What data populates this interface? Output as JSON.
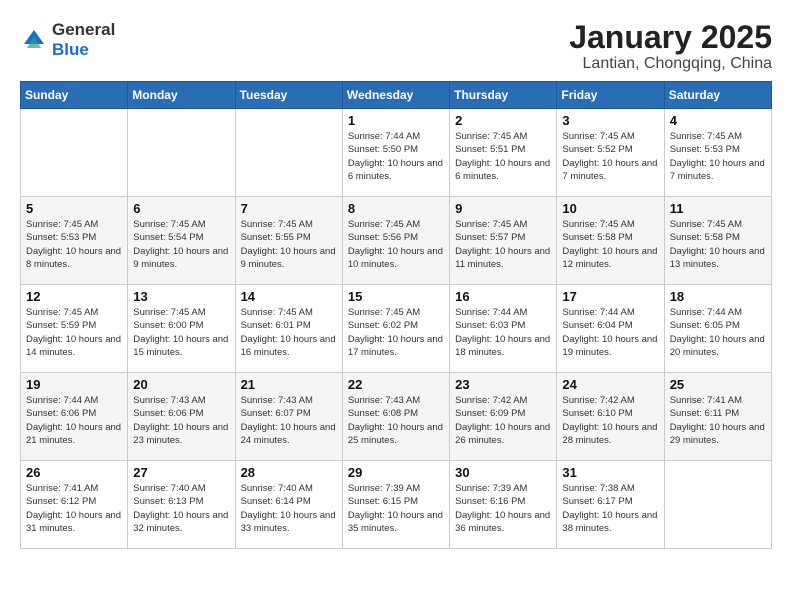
{
  "logo": {
    "text_general": "General",
    "text_blue": "Blue"
  },
  "header": {
    "month_year": "January 2025",
    "location": "Lantian, Chongqing, China"
  },
  "weekdays": [
    "Sunday",
    "Monday",
    "Tuesday",
    "Wednesday",
    "Thursday",
    "Friday",
    "Saturday"
  ],
  "weeks": [
    [
      {
        "day": "",
        "info": ""
      },
      {
        "day": "",
        "info": ""
      },
      {
        "day": "",
        "info": ""
      },
      {
        "day": "1",
        "info": "Sunrise: 7:44 AM\nSunset: 5:50 PM\nDaylight: 10 hours and 6 minutes."
      },
      {
        "day": "2",
        "info": "Sunrise: 7:45 AM\nSunset: 5:51 PM\nDaylight: 10 hours and 6 minutes."
      },
      {
        "day": "3",
        "info": "Sunrise: 7:45 AM\nSunset: 5:52 PM\nDaylight: 10 hours and 7 minutes."
      },
      {
        "day": "4",
        "info": "Sunrise: 7:45 AM\nSunset: 5:53 PM\nDaylight: 10 hours and 7 minutes."
      }
    ],
    [
      {
        "day": "5",
        "info": "Sunrise: 7:45 AM\nSunset: 5:53 PM\nDaylight: 10 hours and 8 minutes."
      },
      {
        "day": "6",
        "info": "Sunrise: 7:45 AM\nSunset: 5:54 PM\nDaylight: 10 hours and 9 minutes."
      },
      {
        "day": "7",
        "info": "Sunrise: 7:45 AM\nSunset: 5:55 PM\nDaylight: 10 hours and 9 minutes."
      },
      {
        "day": "8",
        "info": "Sunrise: 7:45 AM\nSunset: 5:56 PM\nDaylight: 10 hours and 10 minutes."
      },
      {
        "day": "9",
        "info": "Sunrise: 7:45 AM\nSunset: 5:57 PM\nDaylight: 10 hours and 11 minutes."
      },
      {
        "day": "10",
        "info": "Sunrise: 7:45 AM\nSunset: 5:58 PM\nDaylight: 10 hours and 12 minutes."
      },
      {
        "day": "11",
        "info": "Sunrise: 7:45 AM\nSunset: 5:58 PM\nDaylight: 10 hours and 13 minutes."
      }
    ],
    [
      {
        "day": "12",
        "info": "Sunrise: 7:45 AM\nSunset: 5:59 PM\nDaylight: 10 hours and 14 minutes."
      },
      {
        "day": "13",
        "info": "Sunrise: 7:45 AM\nSunset: 6:00 PM\nDaylight: 10 hours and 15 minutes."
      },
      {
        "day": "14",
        "info": "Sunrise: 7:45 AM\nSunset: 6:01 PM\nDaylight: 10 hours and 16 minutes."
      },
      {
        "day": "15",
        "info": "Sunrise: 7:45 AM\nSunset: 6:02 PM\nDaylight: 10 hours and 17 minutes."
      },
      {
        "day": "16",
        "info": "Sunrise: 7:44 AM\nSunset: 6:03 PM\nDaylight: 10 hours and 18 minutes."
      },
      {
        "day": "17",
        "info": "Sunrise: 7:44 AM\nSunset: 6:04 PM\nDaylight: 10 hours and 19 minutes."
      },
      {
        "day": "18",
        "info": "Sunrise: 7:44 AM\nSunset: 6:05 PM\nDaylight: 10 hours and 20 minutes."
      }
    ],
    [
      {
        "day": "19",
        "info": "Sunrise: 7:44 AM\nSunset: 6:06 PM\nDaylight: 10 hours and 21 minutes."
      },
      {
        "day": "20",
        "info": "Sunrise: 7:43 AM\nSunset: 6:06 PM\nDaylight: 10 hours and 23 minutes."
      },
      {
        "day": "21",
        "info": "Sunrise: 7:43 AM\nSunset: 6:07 PM\nDaylight: 10 hours and 24 minutes."
      },
      {
        "day": "22",
        "info": "Sunrise: 7:43 AM\nSunset: 6:08 PM\nDaylight: 10 hours and 25 minutes."
      },
      {
        "day": "23",
        "info": "Sunrise: 7:42 AM\nSunset: 6:09 PM\nDaylight: 10 hours and 26 minutes."
      },
      {
        "day": "24",
        "info": "Sunrise: 7:42 AM\nSunset: 6:10 PM\nDaylight: 10 hours and 28 minutes."
      },
      {
        "day": "25",
        "info": "Sunrise: 7:41 AM\nSunset: 6:11 PM\nDaylight: 10 hours and 29 minutes."
      }
    ],
    [
      {
        "day": "26",
        "info": "Sunrise: 7:41 AM\nSunset: 6:12 PM\nDaylight: 10 hours and 31 minutes."
      },
      {
        "day": "27",
        "info": "Sunrise: 7:40 AM\nSunset: 6:13 PM\nDaylight: 10 hours and 32 minutes."
      },
      {
        "day": "28",
        "info": "Sunrise: 7:40 AM\nSunset: 6:14 PM\nDaylight: 10 hours and 33 minutes."
      },
      {
        "day": "29",
        "info": "Sunrise: 7:39 AM\nSunset: 6:15 PM\nDaylight: 10 hours and 35 minutes."
      },
      {
        "day": "30",
        "info": "Sunrise: 7:39 AM\nSunset: 6:16 PM\nDaylight: 10 hours and 36 minutes."
      },
      {
        "day": "31",
        "info": "Sunrise: 7:38 AM\nSunset: 6:17 PM\nDaylight: 10 hours and 38 minutes."
      },
      {
        "day": "",
        "info": ""
      }
    ]
  ]
}
